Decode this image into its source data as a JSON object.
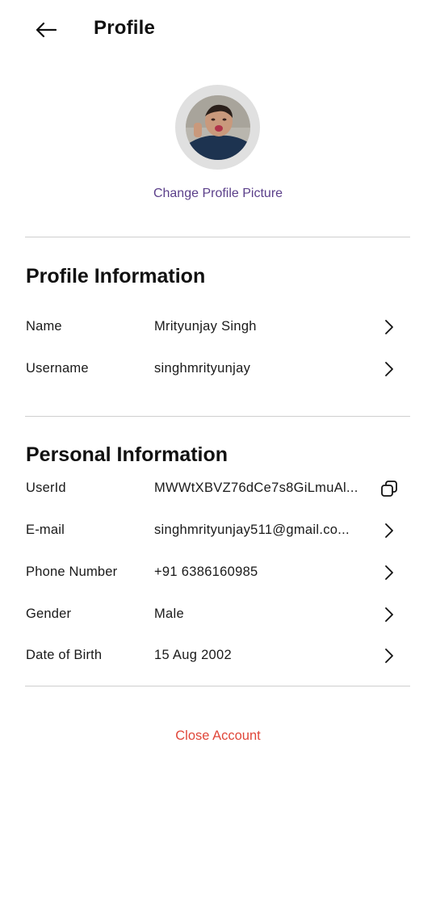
{
  "header": {
    "title": "Profile",
    "back_icon": "arrow-left-icon"
  },
  "avatar": {
    "change_label": "Change Profile Picture"
  },
  "profile_information": {
    "title": "Profile Information",
    "rows": [
      {
        "label": "Name",
        "value": "Mrityunjay Singh",
        "icon": "chevron-right-icon"
      },
      {
        "label": "Username",
        "value": "singhmrityunjay",
        "icon": "chevron-right-icon"
      }
    ]
  },
  "personal_information": {
    "title": "Personal Information",
    "rows": [
      {
        "label": "UserId",
        "value": "MWWtXBVZ76dCe7s8GiLmuAl...",
        "icon": "copy-icon"
      },
      {
        "label": "E-mail",
        "value": "singhmrityunjay511@gmail.co...",
        "icon": "chevron-right-icon"
      },
      {
        "label": "Phone Number",
        "value": "+91 6386160985",
        "icon": "chevron-right-icon"
      },
      {
        "label": "Gender",
        "value": "Male",
        "icon": "chevron-right-icon"
      },
      {
        "label": "Date of Birth",
        "value": "15 Aug 2002",
        "icon": "chevron-right-icon"
      }
    ]
  },
  "footer": {
    "close_account_label": "Close Account"
  },
  "colors": {
    "accent_purple": "#5b3f8a",
    "danger_red": "#e0473a",
    "divider": "#cfcfcf",
    "avatar_ring": "#e0e0e0"
  }
}
